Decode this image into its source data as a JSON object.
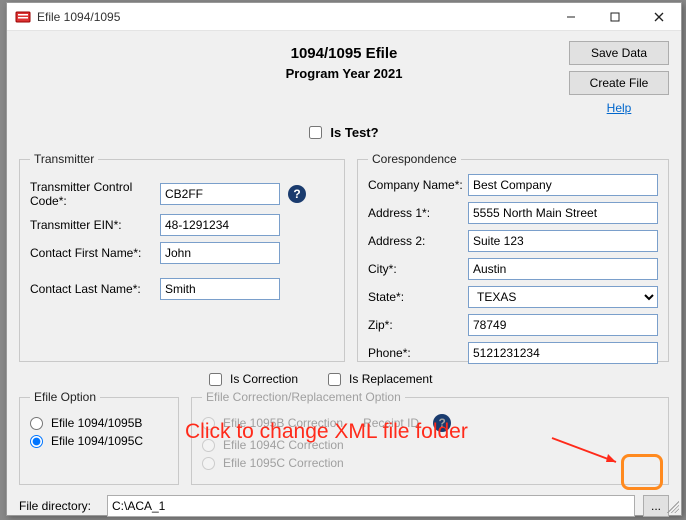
{
  "window": {
    "title": "Efile 1094/1095"
  },
  "header": {
    "title": "1094/1095 Efile",
    "subtitle": "Program Year 2021",
    "save_btn": "Save Data",
    "create_btn": "Create File",
    "help_link": "Help",
    "is_test_label": "Is Test?"
  },
  "transmitter": {
    "legend": "Transmitter",
    "control_code_label": "Transmitter Control Code*:",
    "control_code": "CB2FF",
    "ein_label": "Transmitter EIN*:",
    "ein": "48-1291234",
    "first_name_label": "Contact First Name*:",
    "first_name": "John",
    "last_name_label": "Contact Last Name*:",
    "last_name": "Smith"
  },
  "corespondence": {
    "legend": "Corespondence",
    "company_label": "Company Name*:",
    "company": "Best Company",
    "addr1_label": "Address 1*:",
    "addr1": "5555 North Main Street",
    "addr2_label": "Address 2:",
    "addr2": "Suite 123",
    "city_label": "City*:",
    "city": "Austin",
    "state_label": "State*:",
    "state": "TEXAS",
    "zip_label": "Zip*:",
    "zip": "78749",
    "phone_label": "Phone*:",
    "phone": "5121231234"
  },
  "checks": {
    "is_correction": "Is Correction",
    "is_replacement": "Is Replacement"
  },
  "efile_option": {
    "legend": "Efile Option",
    "opt_b": "Efile 1094/1095B",
    "opt_c": "Efile 1094/1095C"
  },
  "efile_correction": {
    "legend": "Efile Correction/Replacement Option",
    "opt_1095b": "Efile 1095B Correction",
    "opt_1094c": "Efile 1094C Correction",
    "opt_1095c": "Efile 1095C Correction",
    "receipt_label": "Receipt ID"
  },
  "file_dir": {
    "label": "File directory:",
    "value": "C:\\ACA_1"
  },
  "annotation": {
    "text": "Click to change XML file folder"
  }
}
